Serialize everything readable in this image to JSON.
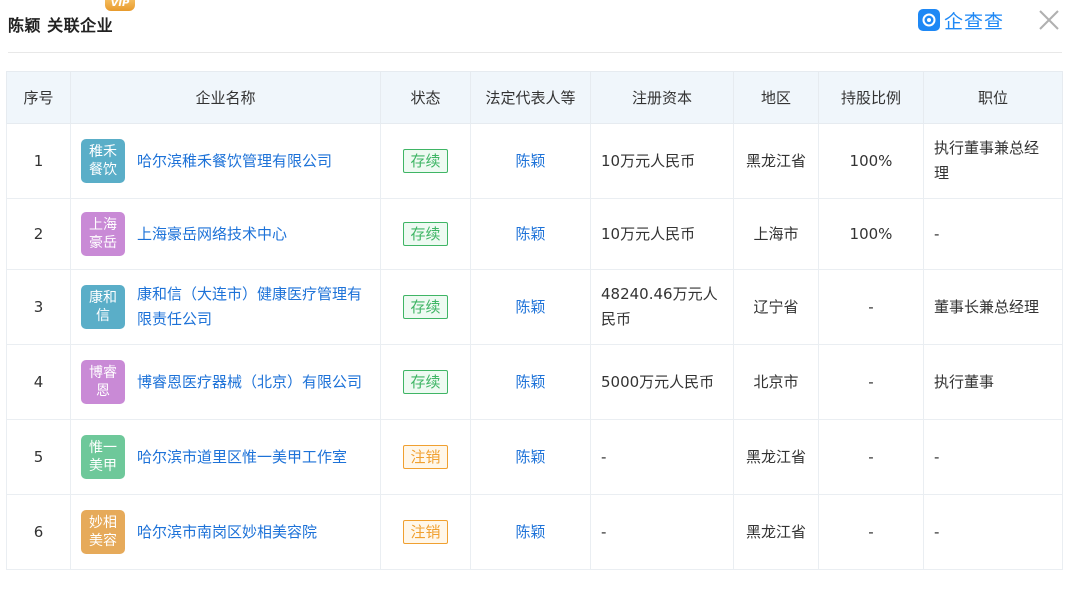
{
  "header": {
    "title": "陈颖 关联企业",
    "vip_badge": "VIP",
    "brand": "企查查",
    "brand_color": "#1e88f5"
  },
  "table": {
    "columns": [
      "序号",
      "企业名称",
      "状态",
      "法定代表人等",
      "注册资本",
      "地区",
      "持股比例",
      "职位"
    ],
    "rows": [
      {
        "no": "1",
        "logo_text": "稚禾餐饮",
        "logo_color": "#5aaec8",
        "company": "哈尔滨稚禾餐饮管理有限公司",
        "status": "存续",
        "status_type": "active",
        "legal_rep": "陈颖",
        "capital": "10万元人民币",
        "region": "黑龙江省",
        "share": "100%",
        "position": "执行董事兼总经理"
      },
      {
        "no": "2",
        "logo_text": "上海豪岳",
        "logo_color": "#c98ad6",
        "company": "上海豪岳网络技术中心",
        "status": "存续",
        "status_type": "active",
        "legal_rep": "陈颖",
        "capital": "10万元人民币",
        "region": "上海市",
        "share": "100%",
        "position": "-"
      },
      {
        "no": "3",
        "logo_text": "康和信",
        "logo_color": "#5aaec8",
        "company": "康和信（大连市）健康医疗管理有限责任公司",
        "status": "存续",
        "status_type": "active",
        "legal_rep": "陈颖",
        "capital": "48240.46万元人民币",
        "region": "辽宁省",
        "share": "-",
        "position": "董事长兼总经理"
      },
      {
        "no": "4",
        "logo_text": "博睿恩",
        "logo_color": "#c98ad6",
        "company": "博睿恩医疗器械（北京）有限公司",
        "status": "存续",
        "status_type": "active",
        "legal_rep": "陈颖",
        "capital": "5000万元人民币",
        "region": "北京市",
        "share": "-",
        "position": "执行董事"
      },
      {
        "no": "5",
        "logo_text": "惟一美甲",
        "logo_color": "#6ec89a",
        "company": "哈尔滨市道里区惟一美甲工作室",
        "status": "注销",
        "status_type": "cancelled",
        "legal_rep": "陈颖",
        "capital": "-",
        "region": "黑龙江省",
        "share": "-",
        "position": "-"
      },
      {
        "no": "6",
        "logo_text": "妙相美容",
        "logo_color": "#e6aa5a",
        "company": "哈尔滨市南岗区妙相美容院",
        "status": "注销",
        "status_type": "cancelled",
        "legal_rep": "陈颖",
        "capital": "-",
        "region": "黑龙江省",
        "share": "-",
        "position": "-"
      }
    ]
  },
  "colors": {
    "active": "#3fb565",
    "active_bg": "#eefaf2",
    "cancelled": "#f0a030",
    "cancelled_bg": "#fff7ea",
    "link": "#1d72d8"
  }
}
